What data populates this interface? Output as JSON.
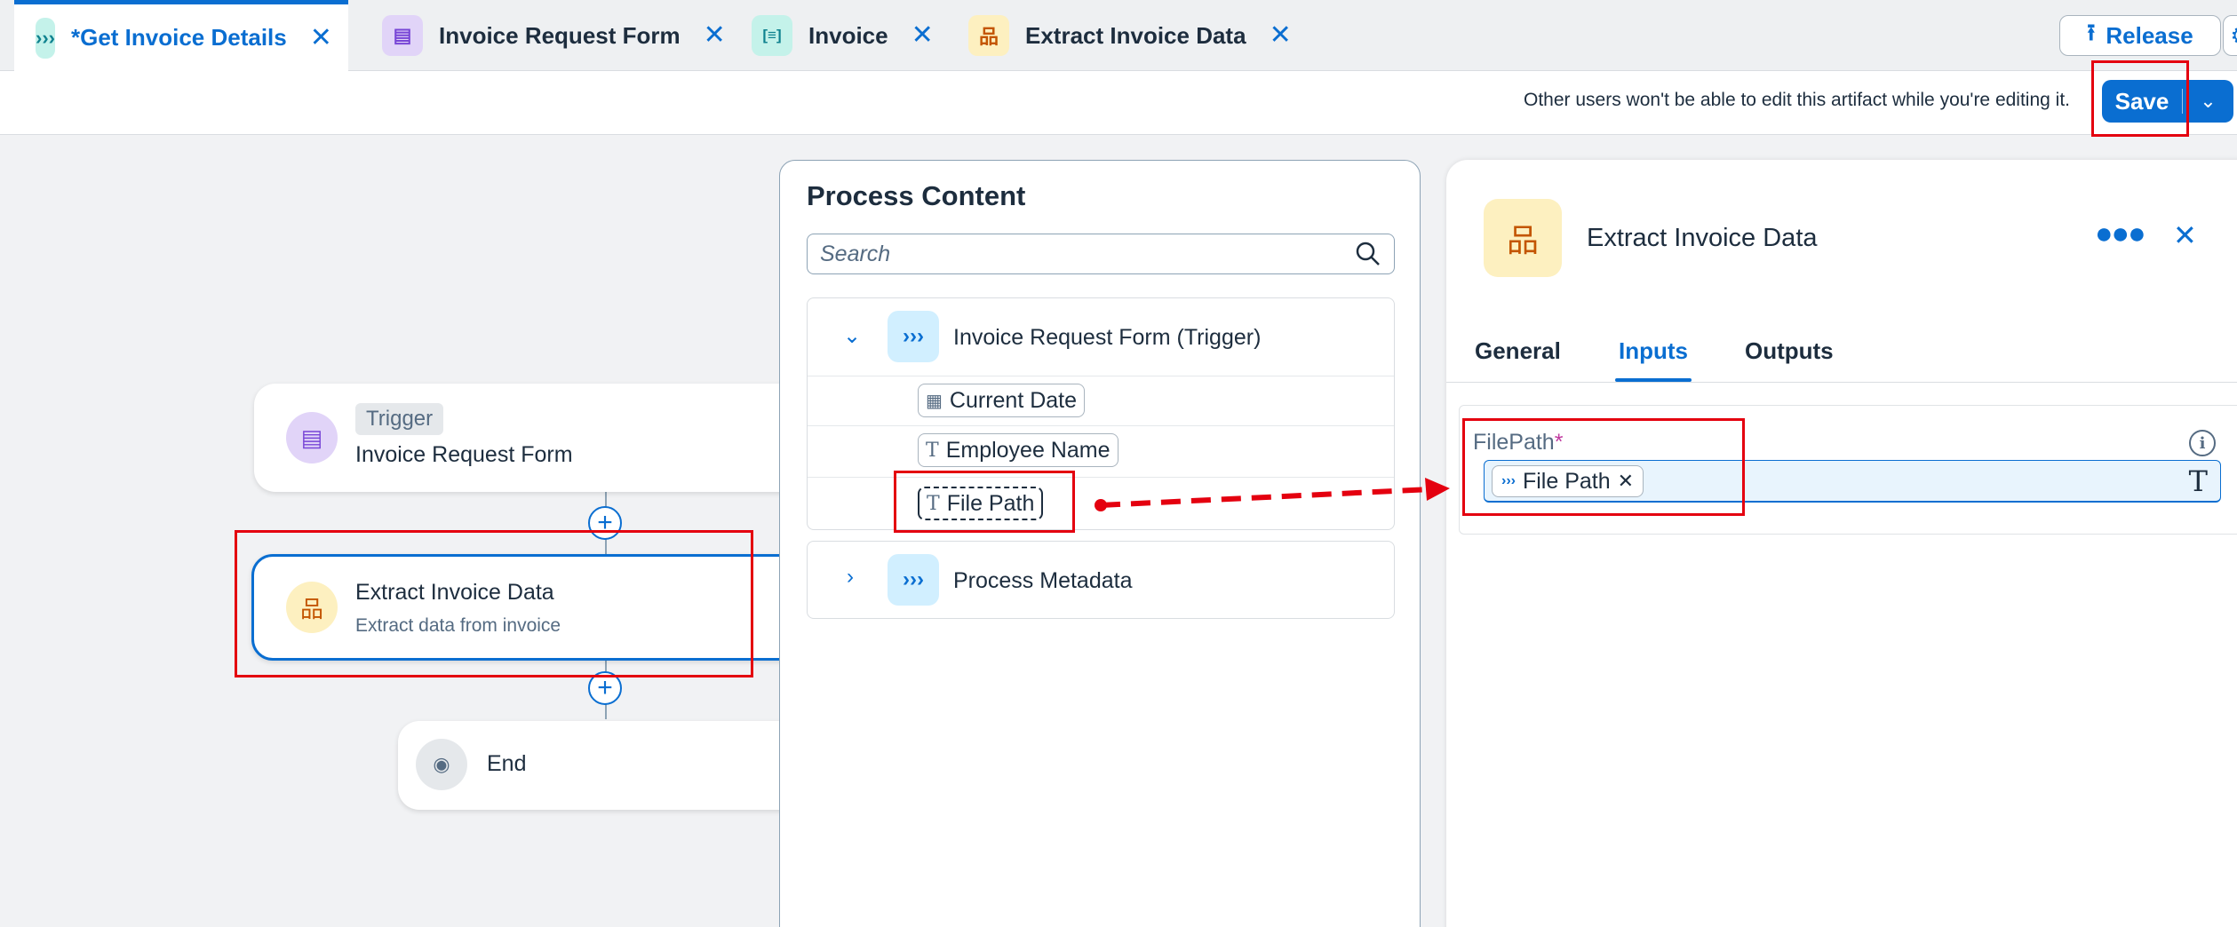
{
  "tabs": [
    {
      "label": "*Get Invoice Details",
      "icon": "flow-icon",
      "glyph": "›››",
      "active": true
    },
    {
      "label": "Invoice Request Form",
      "icon": "form-icon",
      "glyph": "▤",
      "active": false
    },
    {
      "label": "Invoice",
      "icon": "document-icon",
      "glyph": "[≡]",
      "active": false
    },
    {
      "label": "Extract Invoice Data",
      "icon": "hierarchy-icon",
      "glyph": "品",
      "active": false
    }
  ],
  "header": {
    "release_label": "Release",
    "edit_notice": "Other users won't be able to edit this artifact while you're editing it.",
    "save_label": "Save"
  },
  "canvas": {
    "trigger_tag": "Trigger",
    "trigger_title": "Invoice Request Form",
    "step_title": "Extract Invoice Data",
    "step_subtitle": "Extract data from invoice",
    "end_label": "End"
  },
  "process_content": {
    "title": "Process Content",
    "search_placeholder": "Search",
    "trigger_group": "Invoice Request Form (Trigger)",
    "fields": [
      "Current Date",
      "Employee Name",
      "File Path"
    ],
    "metadata_group": "Process Metadata"
  },
  "properties": {
    "title": "Extract Invoice Data",
    "tabs": [
      "General",
      "Inputs",
      "Outputs"
    ],
    "selected_tab": "Inputs",
    "field_label": "FilePath",
    "required_marker": "*",
    "field_value": "File Path",
    "type_glyph": "T"
  },
  "colors": {
    "accent": "#0a6ed1",
    "highlight_red": "#e4000f"
  }
}
